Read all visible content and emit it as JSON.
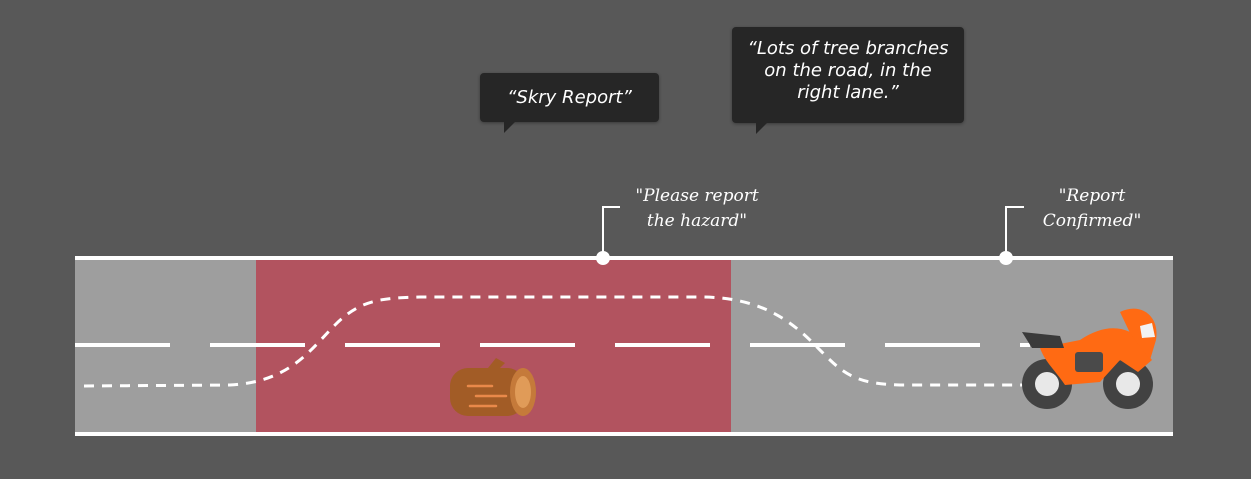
{
  "bubbles": {
    "skry": "“Skry Report”",
    "branches_lines": [
      "“Lots of tree branches",
      "on the road, in the",
      "right lane.”"
    ]
  },
  "callouts": {
    "report_request_lines": [
      "\"Please report",
      "the hazard\""
    ],
    "report_confirmed_lines": [
      "\"Report",
      "Confirmed\""
    ]
  },
  "colors": {
    "background": "#585858",
    "road": "#9e9e9e",
    "hazard_zone": "#b2535f",
    "lane_marking": "#ffffff",
    "bubble": "#262626",
    "log": "#a25c26",
    "motorcycle": "#ff6a13"
  },
  "icons": {
    "hazard": "log-icon",
    "rider": "motorcycle-icon"
  }
}
